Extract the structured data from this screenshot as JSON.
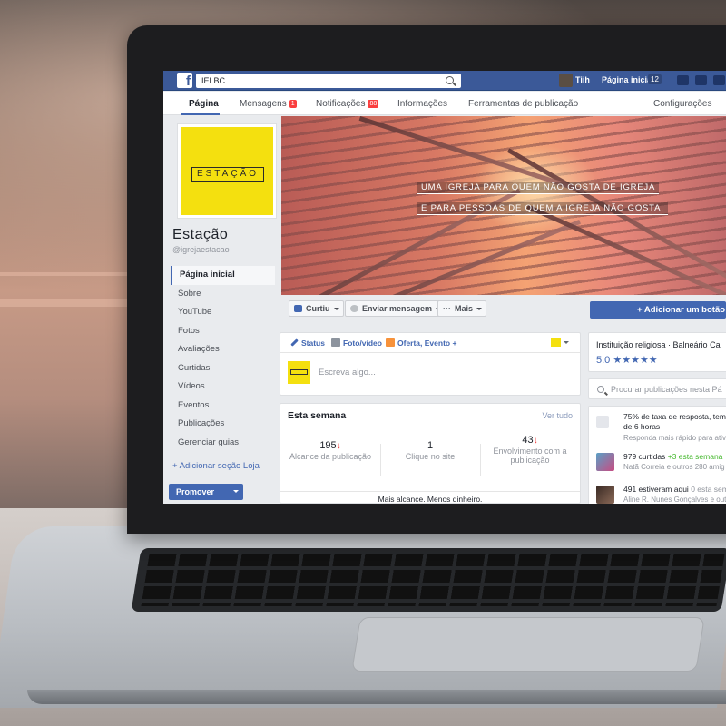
{
  "topbar": {
    "search_value": "IELBC",
    "user_name": "Tiih",
    "home_label": "Página inicial",
    "home_count": "12"
  },
  "page_tabs": [
    {
      "label": "Página"
    },
    {
      "label": "Mensagens",
      "badge": "1"
    },
    {
      "label": "Notificações",
      "badge": "88"
    },
    {
      "label": "Informações"
    },
    {
      "label": "Ferramentas de publicação"
    },
    {
      "label": "Configurações"
    }
  ],
  "profile": {
    "logo_text": "ESTAÇÃO",
    "name": "Estação",
    "handle": "@igrejaestacao"
  },
  "left_nav": [
    "Página inicial",
    "Sobre",
    "YouTube",
    "Fotos",
    "Avaliações",
    "Curtidas",
    "Vídeos",
    "Eventos",
    "Publicações",
    "Gerenciar guias"
  ],
  "add_section": "Adicionar seção Loja",
  "promote_label": "Promover",
  "cover": {
    "line1": "UMA IGREJA PARA QUEM NÃO GOSTA DE IGREJA",
    "line2": "E PARA PESSOAS DE QUEM A IGREJA NÃO GOSTA."
  },
  "actions": {
    "like": "Curtiu",
    "message": "Enviar mensagem",
    "more": "Mais",
    "add_button": "Adicionar um botão"
  },
  "composer": {
    "tab_status": "Status",
    "tab_photo": "Foto/vídeo",
    "tab_offer": "Oferta, Evento +",
    "placeholder": "Escreva algo..."
  },
  "week": {
    "title": "Esta semana",
    "link": "Ver tudo",
    "stats": [
      {
        "value": "195",
        "label": "Alcance da publicação"
      },
      {
        "value": "1",
        "label": "Clique no site"
      },
      {
        "value": "43",
        "label": "Envolvimento com a publicação"
      }
    ],
    "footer": "Mais alcance. Menos dinheiro."
  },
  "right": {
    "type": "Instituição religiosa · Balneário Ca",
    "rating": "5.0",
    "stars": "★★★★★",
    "search_placeholder": "Procurar publicações nesta Pá",
    "response_line1": "75% de taxa de resposta, tempo de",
    "response_line2": "de 6 horas",
    "response_sub": "Responda mais rápido para ativar",
    "likes_count": "979 curtidas",
    "likes_week": "+3 esta semana",
    "likes_sub": "Natã Correia e outros 280 amig",
    "checkins": "491 estiveram aqui",
    "checkins_week": "0 esta sema",
    "checkins_sub": "Aline R. Nunes Gonçalves e out"
  },
  "colors": {
    "fb_blue": "#3b5998",
    "button_blue": "#4267b2",
    "brand_yellow": "#f4e00f"
  }
}
